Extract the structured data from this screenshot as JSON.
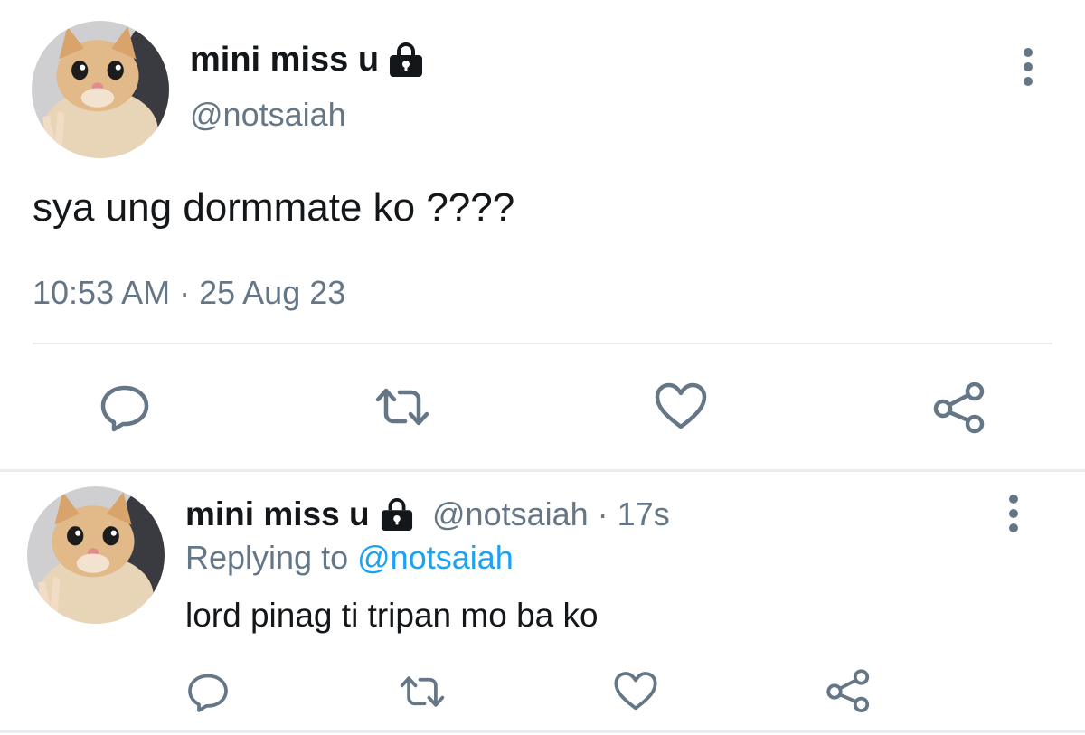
{
  "main_tweet": {
    "display_name": "mini miss u",
    "handle": "@notsaiah",
    "text": "sya ung dormmate ko ????",
    "timestamp": "10:53 AM · 25 Aug 23",
    "actions": [
      "reply-icon",
      "retweet-icon",
      "like-icon",
      "share-icon"
    ]
  },
  "reply_tweet": {
    "display_name": "mini miss u",
    "handle": "@notsaiah",
    "time": "17s",
    "replying_label": "Replying to",
    "replying_to": "@notsaiah",
    "text": "lord pinag ti tripan mo ba ko",
    "actions": [
      "reply-icon",
      "retweet-icon",
      "like-icon",
      "share-icon"
    ]
  },
  "colors": {
    "text": "#14171a",
    "secondary": "#657786",
    "link": "#1da1f2",
    "divider": "#e6ecf0"
  }
}
